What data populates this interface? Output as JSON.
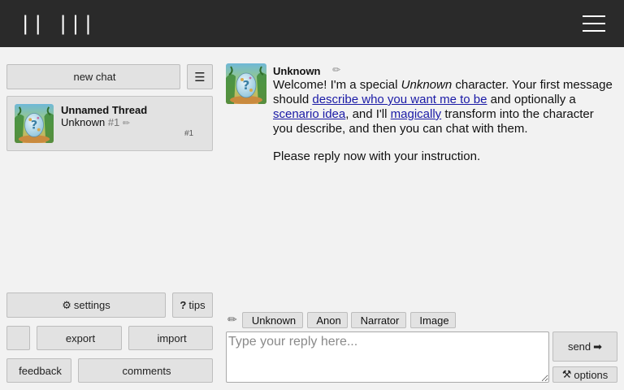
{
  "header": {
    "logo_text": "|| |||",
    "menu_icon": "hamburger-icon"
  },
  "sidebar": {
    "new_chat": {
      "icon": "",
      "label": "new chat"
    },
    "menu_icon_glyph": "☰",
    "threads": [
      {
        "title": "Unnamed Thread",
        "character": "Unknown",
        "number": "#1",
        "edit_glyph": "✏",
        "count_badge": "#1",
        "icon_glyph_1": "",
        "icon_glyph_2": "",
        "icon_glyph_3": ""
      }
    ],
    "bottom": {
      "settings": {
        "icon": "⚙",
        "label": "settings"
      },
      "tips": {
        "icon": "?",
        "label": "tips"
      },
      "icon_only": {
        "icon": ""
      },
      "export": {
        "icon": "",
        "label": "export"
      },
      "import": {
        "icon": "",
        "label": "import"
      },
      "feedback": {
        "icon": "",
        "label": "feedback"
      },
      "comments": {
        "icon": "",
        "label": "comments"
      }
    }
  },
  "message": {
    "name": "Unknown",
    "action_glyphs": [
      "✏",
      "",
      "",
      ""
    ],
    "welcome_before": "Welcome! I'm a special ",
    "welcome_em": "Unknown",
    "welcome_mid1": " character. Your first message should ",
    "link_describe": "describe who you want me to be",
    "welcome_mid2": " and optionally a ",
    "link_scenario": "scenario idea",
    "welcome_mid3": ", and I'll ",
    "link_magically": "magically",
    "welcome_end": " transform into the character you describe, and then you can chat with them.",
    "reply_prompt": "Please reply now with your instruction."
  },
  "composer": {
    "pencil_glyph": "✏",
    "speakers": [
      {
        "icon": "",
        "label": "Unknown"
      },
      {
        "icon": "",
        "label": "Anon"
      },
      {
        "icon": "",
        "label": "Narrator"
      },
      {
        "icon": "",
        "label": "Image"
      }
    ],
    "placeholder": "Type your reply here...",
    "send": {
      "label": "send",
      "icon": "➡"
    },
    "options": {
      "icon": "⚒",
      "label": "options"
    }
  }
}
